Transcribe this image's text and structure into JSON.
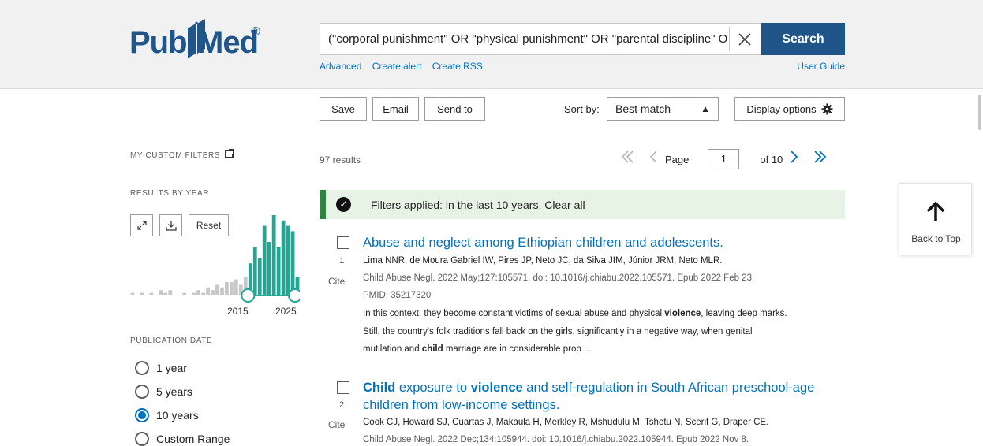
{
  "brand": {
    "name_part1": "Pub",
    "name_part2": "Med",
    "registered": "®"
  },
  "search": {
    "query": "(\"corporal punishment\" OR \"physical punishment\" OR \"parental discipline\" O",
    "button": "Search",
    "clear_icon": "close-icon"
  },
  "sublinks": [
    "Advanced",
    "Create alert",
    "Create RSS"
  ],
  "user_guide": "User Guide",
  "toolbar": {
    "save": "Save",
    "email": "Email",
    "send_to": "Send to",
    "sort_by_label": "Sort by:",
    "sort_value": "Best match",
    "display_options": "Display options"
  },
  "sidebar": {
    "my_custom_filters": "MY CUSTOM FILTERS",
    "results_by_year": "RESULTS BY YEAR",
    "reset": "Reset",
    "year_start": "2015",
    "year_end": "2025",
    "publication_date": "PUBLICATION DATE",
    "date_options": [
      {
        "label": "1 year",
        "selected": false
      },
      {
        "label": "5 years",
        "selected": false
      },
      {
        "label": "10 years",
        "selected": true
      },
      {
        "label": "Custom Range",
        "selected": false
      }
    ]
  },
  "results": {
    "count": "97 results",
    "page_label": "Page",
    "page_value": "1",
    "of_pages": "of 10",
    "filters_text": "Filters applied: in the last 10 years.",
    "clear_all": "Clear all",
    "items": [
      {
        "number": "1",
        "cite": "Cite",
        "title": "Abuse and neglect among Ethiopian children and adolescents.",
        "authors": "Lima NNR, de Moura Gabriel IW, Pires JP, Neto JC, da Silva JIM, Júnior JRM, Neto MLR.",
        "citation": "Child Abuse Negl. 2022 May;127:105571. doi: 10.1016/j.chiabu.2022.105571. Epub 2022 Feb 23.",
        "pmid": "PMID: 35217320",
        "snippet1_a": "In this context, they become constant victims of sexual abuse and physical ",
        "snippet1_b": "violence",
        "snippet1_c": ", leaving deep marks.",
        "snippet2": "Still, the country's folk traditions fall back on the girls, significantly in a negative way, when genital",
        "snippet3_a": "mutilation and ",
        "snippet3_b": "child",
        "snippet3_c": " marriage are in considerable prop ..."
      },
      {
        "number": "2",
        "cite": "Cite",
        "title_a": "Child",
        "title_b": " exposure to ",
        "title_c": "violence",
        "title_d": " and self-regulation in South African preschool-age",
        "title_line2": "children from low-income settings.",
        "authors": "Cook CJ, Howard SJ, Cuartas J, Makaula H, Merkley R, Mshudulu M, Tshetu N, Scerif G, Draper CE.",
        "citation": "Child Abuse Negl. 2022 Dec;134:105944. doi: 10.1016/j.chiabu.2022.105944. Epub 2022 Nov 8."
      }
    ]
  },
  "back_to_top": "Back to Top",
  "chart_data": {
    "type": "bar",
    "title": "",
    "x": [
      1990,
      1991,
      1992,
      1993,
      1994,
      1995,
      1996,
      1997,
      1998,
      1999,
      2000,
      2001,
      2002,
      2003,
      2004,
      2005,
      2006,
      2007,
      2008,
      2009,
      2010,
      2011,
      2012,
      2013,
      2014,
      2015,
      2016,
      2017,
      2018,
      2019,
      2020,
      2021,
      2022,
      2023,
      2024,
      2025
    ],
    "values": [
      1,
      0,
      1,
      0,
      1,
      0,
      2,
      1,
      2,
      0,
      0,
      1,
      0,
      1,
      2,
      1,
      3,
      2,
      4,
      3,
      5,
      5,
      6,
      4,
      7,
      12,
      18,
      14,
      26,
      20,
      30,
      18,
      28,
      26,
      24,
      7
    ],
    "selected_range": [
      2015,
      2025
    ],
    "colors": {
      "selected": "#20a895",
      "unselected": "#c8c8c8"
    }
  },
  "colors": {
    "brand": "#20558a",
    "link": "#0071bc",
    "success": "#2e8540"
  }
}
